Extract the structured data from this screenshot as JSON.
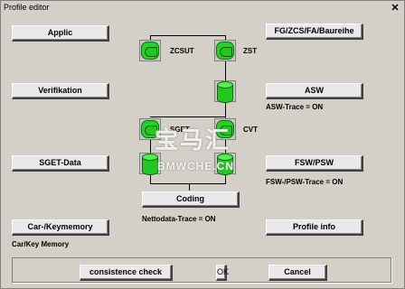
{
  "window": {
    "title": "Profile editor",
    "close_label": "✕"
  },
  "buttons": {
    "applic": "Applic",
    "fg": "FG/ZCS/FA/Baureihe",
    "verifikation": "Verifikation",
    "asw": "ASW",
    "sget_data": "SGET-Data",
    "fsw_psw": "FSW/PSW",
    "coding": "Coding",
    "car_keymemory": "Car-/Keymemory",
    "profile_info": "Profile info",
    "consistence_check": "consistence check",
    "ok": "OK",
    "cancel": "Cancel"
  },
  "labels": {
    "zcsut": "ZCSUT",
    "zst": "ZST",
    "sget": "SGET",
    "cvt": "CVT",
    "asw_trace": "ASW-Trace = ON",
    "fsw_trace": "FSW-/PSW-Trace = ON",
    "nettodata_trace": "Nettodata-Trace = ON",
    "car_key_memory": "Car/Key Memory"
  },
  "watermark": {
    "line1": "宝马汇",
    "line2": "BMWCHE.CN"
  },
  "colors": {
    "ecu_green": "#24d424",
    "background": "#d4d0c8"
  }
}
